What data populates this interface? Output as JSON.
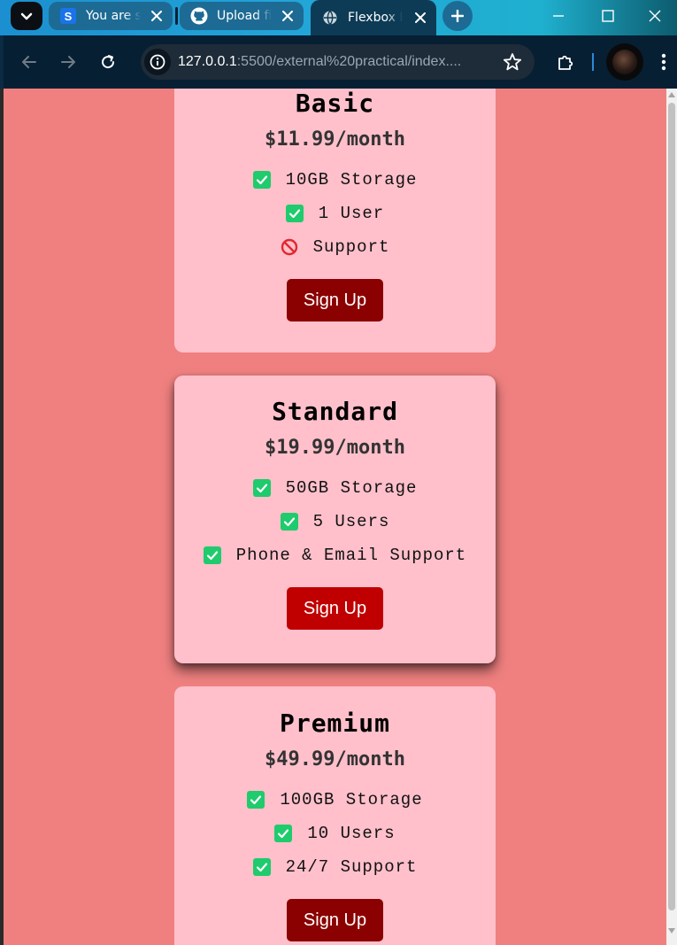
{
  "browser": {
    "tabs": [
      {
        "title": "You are s",
        "favicon": "s-letter-icon",
        "active": false
      },
      {
        "title": "Upload fi",
        "favicon": "github-icon",
        "active": false
      },
      {
        "title": "Flexbox P",
        "favicon": "globe-icon",
        "active": true
      }
    ],
    "url_host": "127.0.0.1",
    "url_rest": ":5500/external%20practical/index...."
  },
  "plans": [
    {
      "name": "Basic",
      "price": "$11.99/month",
      "features": [
        {
          "text": "10GB Storage",
          "icon": "check-icon"
        },
        {
          "text": "1 User",
          "icon": "check-icon"
        },
        {
          "text": "Support",
          "icon": "prohibited-icon"
        }
      ],
      "button": "Sign Up",
      "button_color": "#8b0000"
    },
    {
      "name": "Standard",
      "price": "$19.99/month",
      "features": [
        {
          "text": "50GB Storage",
          "icon": "check-icon"
        },
        {
          "text": "5 Users",
          "icon": "check-icon"
        },
        {
          "text": "Phone & Email Support",
          "icon": "check-icon"
        }
      ],
      "button": "Sign Up",
      "button_color": "#c00000"
    },
    {
      "name": "Premium",
      "price": "$49.99/month",
      "features": [
        {
          "text": "100GB Storage",
          "icon": "check-icon"
        },
        {
          "text": "10 Users",
          "icon": "check-icon"
        },
        {
          "text": "24/7 Support",
          "icon": "check-icon"
        }
      ],
      "button": "Sign Up",
      "button_color": "#8b0000"
    }
  ],
  "colors": {
    "page_background": "#f08080",
    "card_background": "#ffc0cb",
    "check_green": "#1fcb6c"
  }
}
